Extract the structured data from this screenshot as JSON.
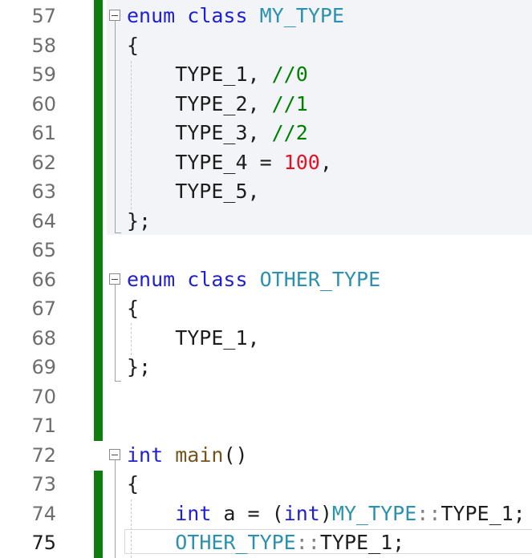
{
  "editor": {
    "lines": [
      {
        "no": "57",
        "tokens": [
          {
            "t": "enum",
            "c": "kw"
          },
          {
            "t": " ",
            "c": "punct"
          },
          {
            "t": "class",
            "c": "kw"
          },
          {
            "t": " ",
            "c": "punct"
          },
          {
            "t": "MY_TYPE",
            "c": "type"
          }
        ]
      },
      {
        "no": "58",
        "tokens": [
          {
            "t": "{",
            "c": "punct"
          }
        ]
      },
      {
        "no": "59",
        "tokens": [
          {
            "t": "    TYPE_1, ",
            "c": "punct"
          },
          {
            "t": "//0",
            "c": "cmt"
          }
        ]
      },
      {
        "no": "60",
        "tokens": [
          {
            "t": "    TYPE_2, ",
            "c": "punct"
          },
          {
            "t": "//1",
            "c": "cmt"
          }
        ]
      },
      {
        "no": "61",
        "tokens": [
          {
            "t": "    TYPE_3, ",
            "c": "punct"
          },
          {
            "t": "//2",
            "c": "cmt"
          }
        ]
      },
      {
        "no": "62",
        "tokens": [
          {
            "t": "    TYPE_4 = ",
            "c": "punct"
          },
          {
            "t": "100",
            "c": "num"
          },
          {
            "t": ",",
            "c": "punct"
          }
        ]
      },
      {
        "no": "63",
        "tokens": [
          {
            "t": "    TYPE_5,",
            "c": "punct"
          }
        ]
      },
      {
        "no": "64",
        "tokens": [
          {
            "t": "};",
            "c": "punct"
          }
        ]
      },
      {
        "no": "65",
        "tokens": []
      },
      {
        "no": "66",
        "tokens": [
          {
            "t": "enum",
            "c": "kw"
          },
          {
            "t": " ",
            "c": "punct"
          },
          {
            "t": "class",
            "c": "kw"
          },
          {
            "t": " ",
            "c": "punct"
          },
          {
            "t": "OTHER_TYPE",
            "c": "type"
          }
        ]
      },
      {
        "no": "67",
        "tokens": [
          {
            "t": "{",
            "c": "punct"
          }
        ]
      },
      {
        "no": "68",
        "tokens": [
          {
            "t": "    TYPE_1,",
            "c": "punct"
          }
        ]
      },
      {
        "no": "69",
        "tokens": [
          {
            "t": "};",
            "c": "punct"
          }
        ]
      },
      {
        "no": "70",
        "tokens": []
      },
      {
        "no": "71",
        "tokens": []
      },
      {
        "no": "72",
        "tokens": [
          {
            "t": "int",
            "c": "kw"
          },
          {
            "t": " ",
            "c": "punct"
          },
          {
            "t": "main",
            "c": "fn"
          },
          {
            "t": "()",
            "c": "punct"
          }
        ]
      },
      {
        "no": "73",
        "tokens": [
          {
            "t": "{",
            "c": "punct"
          }
        ]
      },
      {
        "no": "74",
        "tokens": [
          {
            "t": "    ",
            "c": "punct"
          },
          {
            "t": "int",
            "c": "kw"
          },
          {
            "t": " a = (",
            "c": "punct"
          },
          {
            "t": "int",
            "c": "kw"
          },
          {
            "t": ")",
            "c": "punct"
          },
          {
            "t": "MY_TYPE",
            "c": "type"
          },
          {
            "t": "::",
            "c": "scope"
          },
          {
            "t": "TYPE_1;",
            "c": "punct"
          }
        ]
      },
      {
        "no": "75",
        "tokens": [
          {
            "t": "    ",
            "c": "punct"
          },
          {
            "t": "OTHER_TYPE",
            "c": "type"
          },
          {
            "t": "::",
            "c": "scope"
          },
          {
            "t": "TYPE_1;",
            "c": "punct"
          }
        ],
        "current": true
      }
    ]
  }
}
